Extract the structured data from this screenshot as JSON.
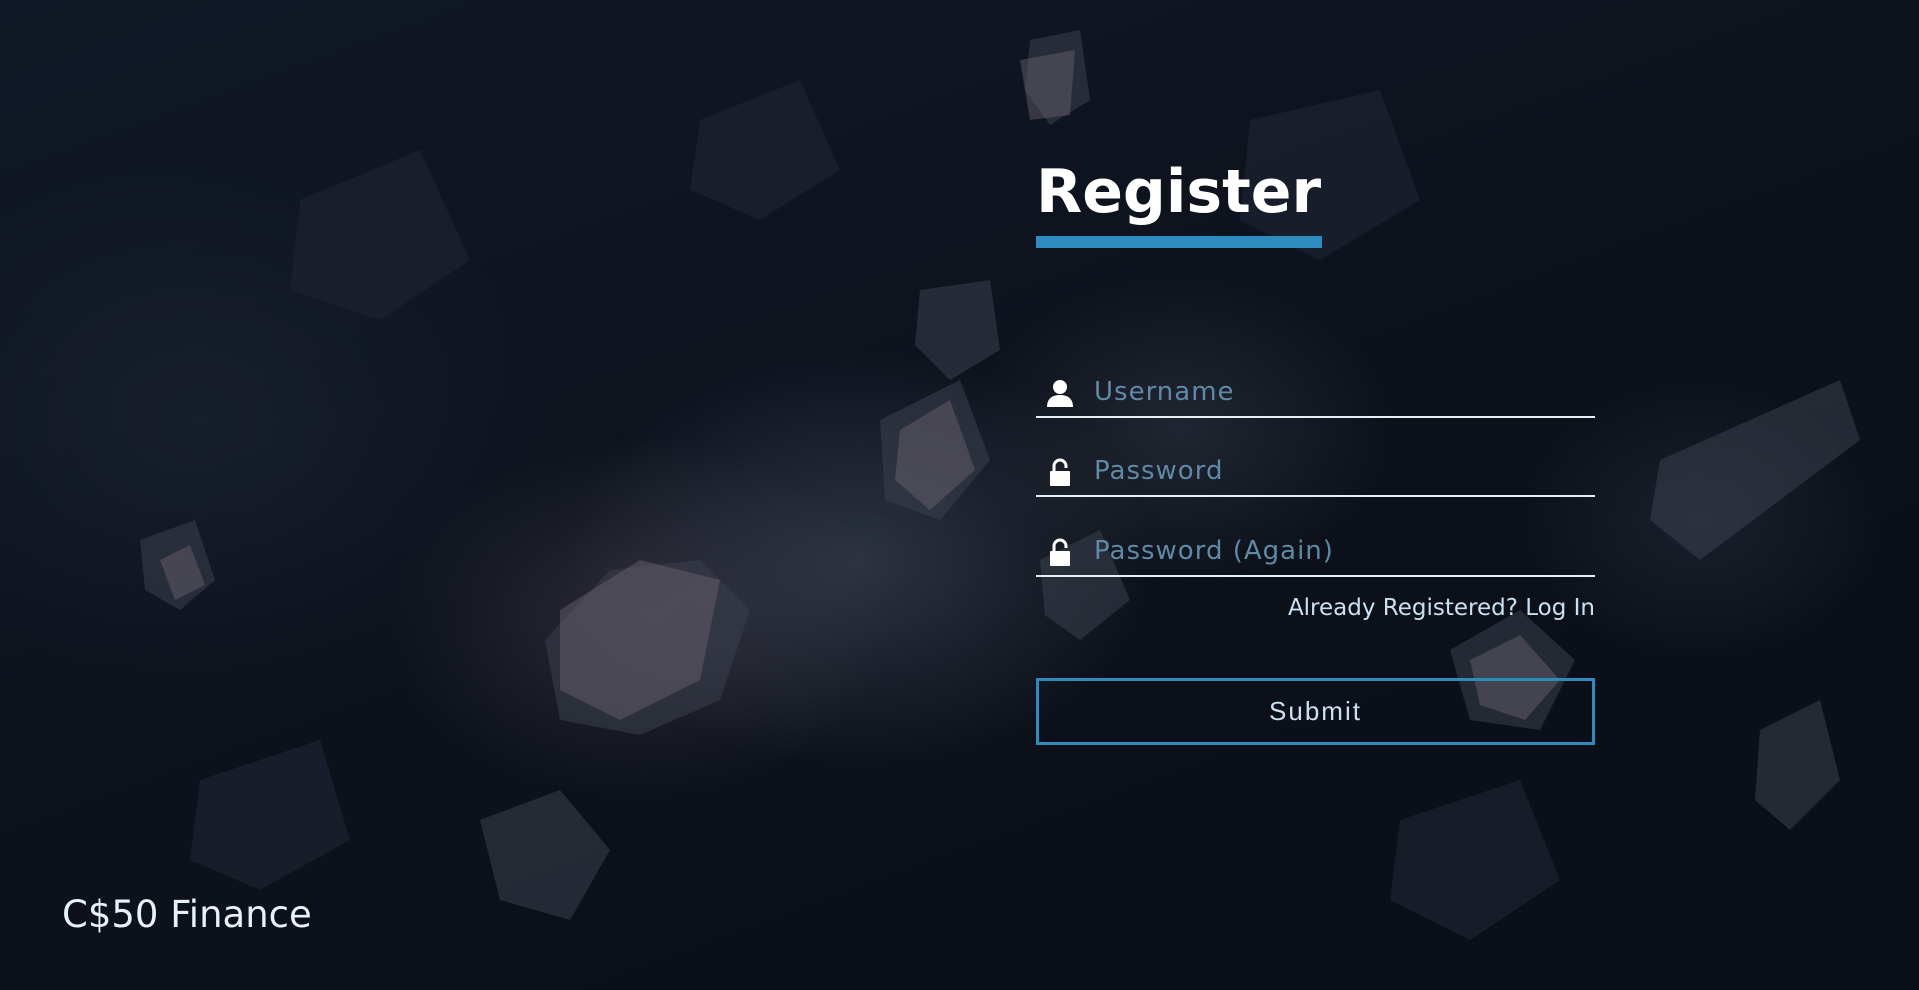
{
  "form": {
    "title": "Register",
    "username": {
      "placeholder": "Username",
      "value": "",
      "icon": "user-icon"
    },
    "password": {
      "placeholder": "Password",
      "value": "",
      "icon": "lock-icon"
    },
    "password_again": {
      "placeholder": "Password (Again)",
      "value": "",
      "icon": "lock-icon"
    },
    "login_link": "Already Registered? Log In",
    "submit_label": "Submit"
  },
  "brand": "C$50 Finance",
  "colors": {
    "accent": "#2e8bc0",
    "background": "#0d121b",
    "text": "#ffffff",
    "placeholder": "#5e8aa6"
  }
}
